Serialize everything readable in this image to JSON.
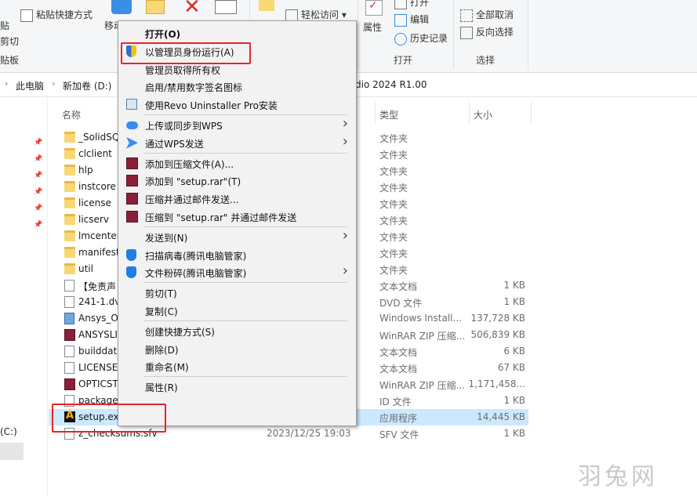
{
  "ribbon": {
    "items": [
      "粘贴快捷方式",
      "贴",
      "剪切",
      "贴板",
      "移动",
      "轻松访问",
      "属性",
      "打开",
      "编辑",
      "历史记录",
      "全部取消",
      "反向选择"
    ],
    "groups": [
      "打开",
      "选择"
    ]
  },
  "address": {
    "crumbs": [
      "此电脑",
      "新加卷 (D:)",
      "dio 2024 R1.00"
    ]
  },
  "nav": {
    "drive": "(C:)"
  },
  "columns": {
    "name": "名称",
    "type": "类型",
    "size": "大小"
  },
  "files": [
    {
      "name": "_SolidSQ",
      "type": "文件夹",
      "size": "",
      "icon": "folder-icon",
      "pinned": true
    },
    {
      "name": "clclient",
      "type": "文件夹",
      "size": "",
      "icon": "folder-icon",
      "pinned": true
    },
    {
      "name": "hlp",
      "type": "文件夹",
      "size": "",
      "icon": "folder-icon",
      "pinned": true
    },
    {
      "name": "instcore",
      "type": "文件夹",
      "size": "",
      "icon": "folder-icon",
      "pinned": true
    },
    {
      "name": "license",
      "type": "文件夹",
      "size": "",
      "icon": "folder-icon",
      "pinned": true
    },
    {
      "name": "licserv",
      "type": "文件夹",
      "size": "",
      "icon": "folder-icon",
      "pinned": true
    },
    {
      "name": "lmcenter",
      "type": "文件夹",
      "size": "",
      "icon": "folder-icon",
      "pinned": false
    },
    {
      "name": "manifest",
      "type": "文件夹",
      "size": "",
      "icon": "folder-icon",
      "pinned": false
    },
    {
      "name": "util",
      "type": "文件夹",
      "size": "",
      "icon": "folder-icon",
      "pinned": false
    },
    {
      "name": "【免责声",
      "type": "文本文档",
      "size": "1 KB",
      "icon": "text-file-icon",
      "pinned": false
    },
    {
      "name": "241-1.dvd",
      "type": "DVD 文件",
      "size": "1 KB",
      "icon": "text-file-icon",
      "pinned": false
    },
    {
      "name": "Ansys_O",
      "type": "Windows Install...",
      "size": "137,728 KB",
      "icon": "installer-icon",
      "pinned": false
    },
    {
      "name": "ANSYSLI",
      "type": "WinRAR ZIP 压缩...",
      "size": "506,839 KB",
      "icon": "winrar-icon",
      "pinned": false
    },
    {
      "name": "builddat",
      "type": "文本文档",
      "size": "6 KB",
      "icon": "text-file-icon",
      "pinned": false
    },
    {
      "name": "LICENSE",
      "type": "文本文档",
      "size": "67 KB",
      "icon": "text-file-icon",
      "pinned": false
    },
    {
      "name": "OPTICST",
      "type": "WinRAR ZIP 压缩...",
      "size": "1,171,458...",
      "icon": "winrar-icon",
      "pinned": false
    },
    {
      "name": "package",
      "type": "ID 文件",
      "size": "1 KB",
      "icon": "text-file-icon",
      "pinned": false
    },
    {
      "name": "setup.exe",
      "type": "应用程序",
      "size": "14,445 KB",
      "icon": "ansys-app-icon",
      "pinned": false,
      "date": ""
    },
    {
      "name": "z_checksums.sfv",
      "type": "SFV 文件",
      "size": "1 KB",
      "icon": "text-file-icon",
      "pinned": false,
      "date": "2023/12/25 19:03"
    }
  ],
  "menu": [
    {
      "label": "打开(O)",
      "bold": true,
      "icon": "",
      "arrow": false
    },
    {
      "label": "以管理员身份运行(A)",
      "icon": "uac-shield-icon",
      "arrow": false
    },
    {
      "label": "管理员取得所有权",
      "icon": "",
      "arrow": false
    },
    {
      "label": "启用/禁用数字签名图标",
      "icon": "",
      "arrow": false
    },
    {
      "label": "使用Revo Uninstaller Pro安装",
      "icon": "revo-icon",
      "arrow": false
    },
    {
      "sep": true
    },
    {
      "label": "上传或同步到WPS",
      "icon": "wps-cloud-icon",
      "arrow": true
    },
    {
      "label": "通过WPS发送",
      "icon": "wps-send-icon",
      "arrow": true
    },
    {
      "sep": true
    },
    {
      "label": "添加到压缩文件(A)...",
      "icon": "winrar-icon",
      "arrow": false
    },
    {
      "label": "添加到 \"setup.rar\"(T)",
      "icon": "winrar-icon",
      "arrow": false
    },
    {
      "label": "压缩并通过邮件发送...",
      "icon": "winrar-icon",
      "arrow": false
    },
    {
      "label": "压缩到 \"setup.rar\" 并通过邮件发送",
      "icon": "winrar-icon",
      "arrow": false
    },
    {
      "sep": true
    },
    {
      "label": "发送到(N)",
      "icon": "",
      "arrow": true
    },
    {
      "label": "扫描病毒(腾讯电脑管家)",
      "icon": "tencent-shield-icon",
      "arrow": false
    },
    {
      "label": "文件粉碎(腾讯电脑管家)",
      "icon": "tencent-shield-icon",
      "arrow": true
    },
    {
      "sep": true
    },
    {
      "label": "剪切(T)",
      "icon": "",
      "arrow": false
    },
    {
      "label": "复制(C)",
      "icon": "",
      "arrow": false
    },
    {
      "sep": true
    },
    {
      "label": "创建快捷方式(S)",
      "icon": "",
      "arrow": false
    },
    {
      "label": "删除(D)",
      "icon": "",
      "arrow": false
    },
    {
      "label": "重命名(M)",
      "icon": "",
      "arrow": false
    },
    {
      "sep": true
    },
    {
      "label": "属性(R)",
      "icon": "",
      "arrow": false
    }
  ],
  "watermark": "羽兔网",
  "colors": {
    "selection": "#cce8ff",
    "highlight": "#e8232b",
    "folder": "#f8d775"
  }
}
